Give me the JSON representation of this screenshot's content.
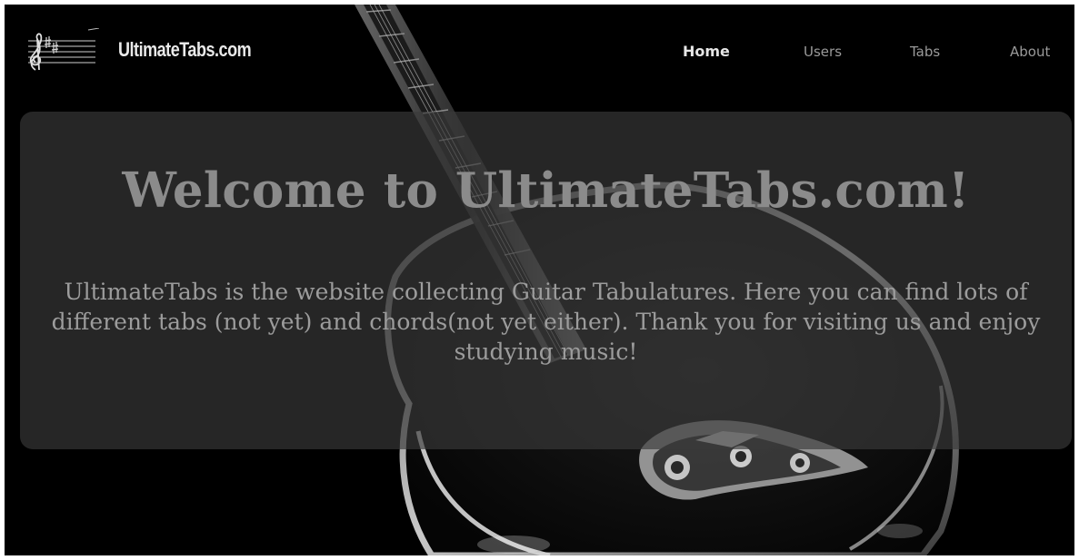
{
  "header": {
    "brand": "UltimateTabs.com",
    "nav": [
      {
        "label": "Home",
        "active": true
      },
      {
        "label": "Users",
        "active": false
      },
      {
        "label": "Tabs",
        "active": false
      },
      {
        "label": "About",
        "active": false
      }
    ]
  },
  "main": {
    "title": "Welcome to UltimateTabs.com!",
    "description": "UltimateTabs is the website collecting Guitar Tabulatures. Here you can find lots of different tabs (not yet) and chords(not yet either). Thank you for visiting us and enjoy studying music!"
  },
  "colors": {
    "background": "#000000",
    "brand_text": "#e9e9e9",
    "nav_active": "#e6e6e6",
    "nav_inactive": "#9a9a9a",
    "panel": "#3a3a3a",
    "title_text": "#8b8b8b",
    "body_text": "#9c9c9c"
  },
  "icons": {
    "logo": "treble-clef-staff-icon",
    "background": "electric-guitar-image"
  }
}
